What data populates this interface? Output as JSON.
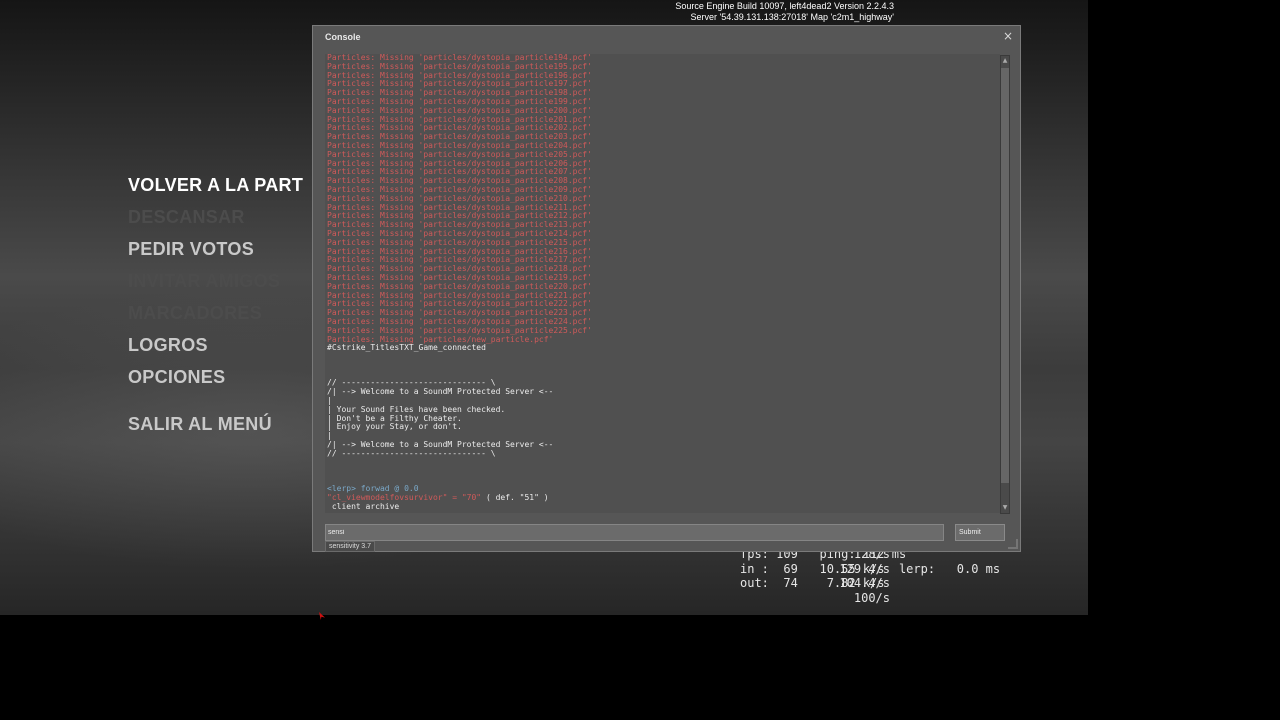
{
  "engine_info": {
    "line1": "Source Engine Build 10097, left4dead2 Version 2.2.4.3",
    "line2": "Server '54.39.131.138:27018' Map 'c2m1_highway'"
  },
  "menu": {
    "items": [
      {
        "label": "VOLVER A LA PART",
        "state": "active"
      },
      {
        "label": "DESCANSAR",
        "state": "disabled"
      },
      {
        "label": "PEDIR VOTOS",
        "state": "normal"
      },
      {
        "label": "INVITAR AMIGOS",
        "state": "disabled"
      },
      {
        "label": "MARCADORES",
        "state": "disabled"
      },
      {
        "label": "LOGROS",
        "state": "normal"
      },
      {
        "label": "OPCIONES",
        "state": "normal"
      },
      {
        "label": "SALIR AL MENÚ",
        "state": "normal"
      }
    ]
  },
  "console": {
    "title": "Console",
    "close_glyph": "×",
    "lines": [
      {
        "text": "Particles: Missing 'particles/dystopia_particle194.pcf'",
        "color": "red"
      },
      {
        "text": "Particles: Missing 'particles/dystopia_particle195.pcf'",
        "color": "red"
      },
      {
        "text": "Particles: Missing 'particles/dystopia_particle196.pcf'",
        "color": "red"
      },
      {
        "text": "Particles: Missing 'particles/dystopia_particle197.pcf'",
        "color": "red"
      },
      {
        "text": "Particles: Missing 'particles/dystopia_particle198.pcf'",
        "color": "red"
      },
      {
        "text": "Particles: Missing 'particles/dystopia_particle199.pcf'",
        "color": "red"
      },
      {
        "text": "Particles: Missing 'particles/dystopia_particle200.pcf'",
        "color": "red"
      },
      {
        "text": "Particles: Missing 'particles/dystopia_particle201.pcf'",
        "color": "red"
      },
      {
        "text": "Particles: Missing 'particles/dystopia_particle202.pcf'",
        "color": "red"
      },
      {
        "text": "Particles: Missing 'particles/dystopia_particle203.pcf'",
        "color": "red"
      },
      {
        "text": "Particles: Missing 'particles/dystopia_particle204.pcf'",
        "color": "red"
      },
      {
        "text": "Particles: Missing 'particles/dystopia_particle205.pcf'",
        "color": "red"
      },
      {
        "text": "Particles: Missing 'particles/dystopia_particle206.pcf'",
        "color": "red"
      },
      {
        "text": "Particles: Missing 'particles/dystopia_particle207.pcf'",
        "color": "red"
      },
      {
        "text": "Particles: Missing 'particles/dystopia_particle208.pcf'",
        "color": "red"
      },
      {
        "text": "Particles: Missing 'particles/dystopia_particle209.pcf'",
        "color": "red"
      },
      {
        "text": "Particles: Missing 'particles/dystopia_particle210.pcf'",
        "color": "red"
      },
      {
        "text": "Particles: Missing 'particles/dystopia_particle211.pcf'",
        "color": "red"
      },
      {
        "text": "Particles: Missing 'particles/dystopia_particle212.pcf'",
        "color": "red"
      },
      {
        "text": "Particles: Missing 'particles/dystopia_particle213.pcf'",
        "color": "red"
      },
      {
        "text": "Particles: Missing 'particles/dystopia_particle214.pcf'",
        "color": "red"
      },
      {
        "text": "Particles: Missing 'particles/dystopia_particle215.pcf'",
        "color": "red"
      },
      {
        "text": "Particles: Missing 'particles/dystopia_particle216.pcf'",
        "color": "red"
      },
      {
        "text": "Particles: Missing 'particles/dystopia_particle217.pcf'",
        "color": "red"
      },
      {
        "text": "Particles: Missing 'particles/dystopia_particle218.pcf'",
        "color": "red"
      },
      {
        "text": "Particles: Missing 'particles/dystopia_particle219.pcf'",
        "color": "red"
      },
      {
        "text": "Particles: Missing 'particles/dystopia_particle220.pcf'",
        "color": "red"
      },
      {
        "text": "Particles: Missing 'particles/dystopia_particle221.pcf'",
        "color": "red"
      },
      {
        "text": "Particles: Missing 'particles/dystopia_particle222.pcf'",
        "color": "red"
      },
      {
        "text": "Particles: Missing 'particles/dystopia_particle223.pcf'",
        "color": "red"
      },
      {
        "text": "Particles: Missing 'particles/dystopia_particle224.pcf'",
        "color": "red"
      },
      {
        "text": "Particles: Missing 'particles/dystopia_particle225.pcf'",
        "color": "red"
      },
      {
        "text": "Particles: Missing 'particles/new_particle.pcf'",
        "color": "red"
      },
      {
        "text": "#Cstrike_TitlesTXT_Game_connected",
        "color": "white"
      },
      {
        "text": "",
        "color": "white"
      },
      {
        "text": "",
        "color": "white"
      },
      {
        "text": "",
        "color": "white"
      },
      {
        "text": "// ------------------------------ \\",
        "color": "white"
      },
      {
        "text": "/| --> Welcome to a SoundM Protected Server <--",
        "color": "white"
      },
      {
        "text": "|",
        "color": "white"
      },
      {
        "text": "| Your Sound Files have been checked.",
        "color": "white"
      },
      {
        "text": "| Don't be a Filthy Cheater.",
        "color": "white"
      },
      {
        "text": "| Enjoy your Stay, or don't.",
        "color": "white"
      },
      {
        "text": "|",
        "color": "white"
      },
      {
        "text": "/| --> Welcome to a SoundM Protected Server <--",
        "color": "white"
      },
      {
        "text": "// ------------------------------ \\",
        "color": "white"
      },
      {
        "text": "",
        "color": "white"
      },
      {
        "text": "",
        "color": "white"
      },
      {
        "text": "",
        "color": "white"
      },
      {
        "text": "<lerp> forwad @ 0.0",
        "color": "blue"
      },
      {
        "text": "\"cl_viewmodelfovsurvivor\" = \"70\" ( def. \"51\" )",
        "color": "mixed",
        "prefix": "\"cl_viewmodelfovsurvivor\" = \"70\"",
        "suffix": " ( def. \"51\" )"
      },
      {
        "text": " client archive",
        "color": "white"
      }
    ],
    "input_value": "sensi",
    "submit_label": "Submit",
    "suggestion": "sensitivity 3.7"
  },
  "netgraph": {
    "line1": "fps: 109   ping: 112 ms",
    "line2": "in :  69   10.55 k/s  lerp:   0.0 ms",
    "line3": "out:  74    7.82 k/s",
    "rates": [
      "128/s",
      "129.4/s",
      "104.4/s",
      "100/s"
    ]
  },
  "colors": {
    "log_red": "#d05a5a",
    "log_white": "#ececec",
    "log_blue": "#7aa8c8",
    "console_bg": "#565656"
  }
}
